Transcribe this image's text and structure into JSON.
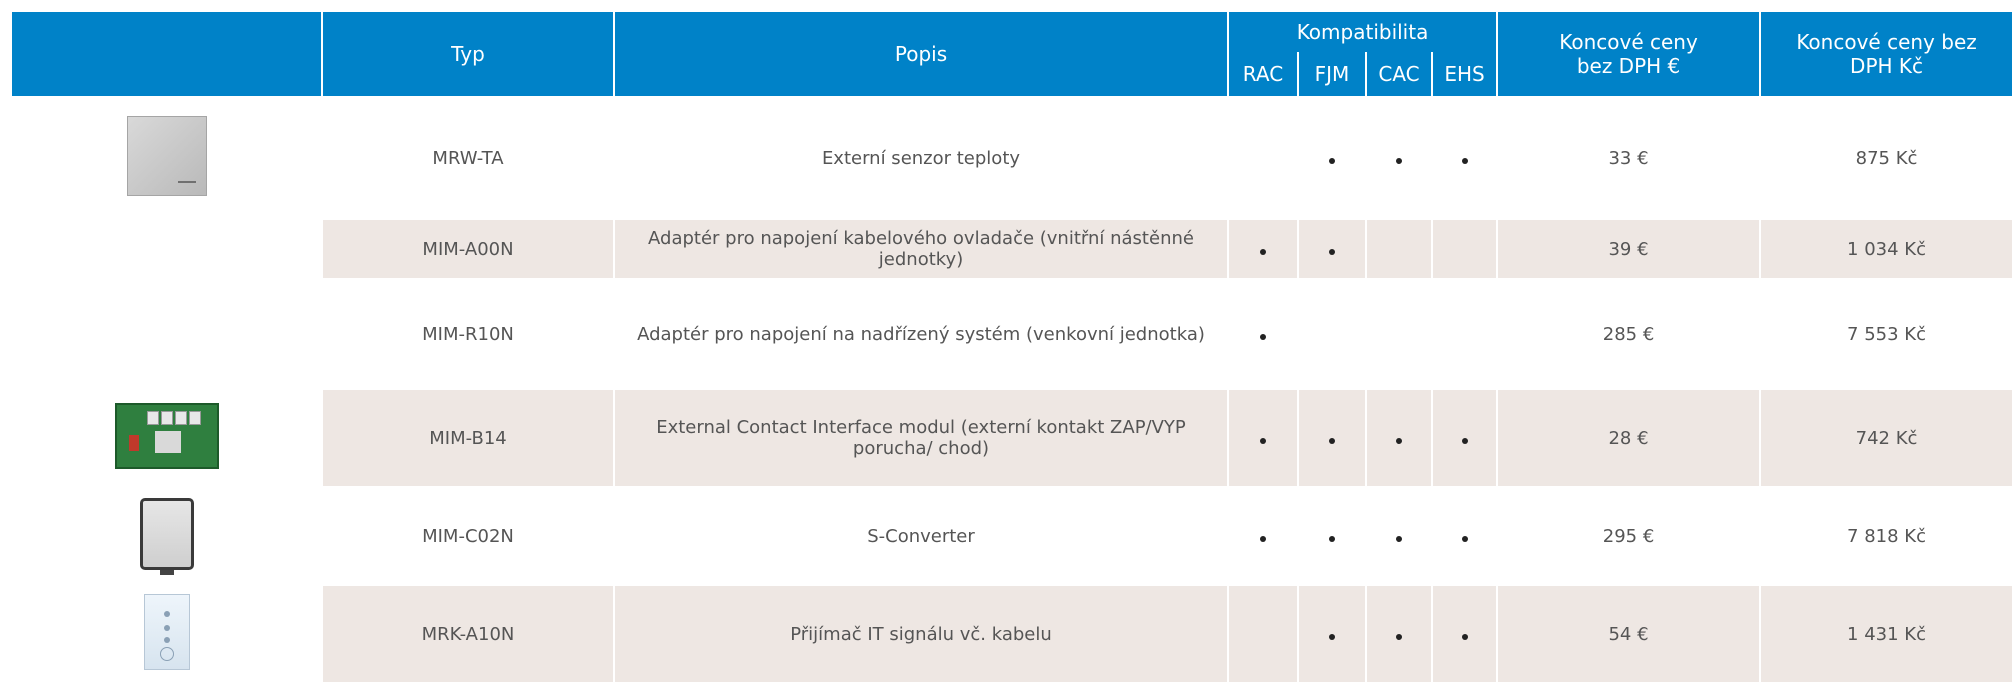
{
  "header": {
    "typ": "Typ",
    "popis": "Popis",
    "kompatibilita": "Kompatibilita",
    "compat_cols": [
      "RAC",
      "FJM",
      "CAC",
      "EHS"
    ],
    "price_eur_line1": "Koncové ceny",
    "price_eur_line2": "bez DPH €",
    "price_czk_line1": "Koncové ceny bez",
    "price_czk_line2": "DPH Kč"
  },
  "rows": [
    {
      "typ": "MRW-TA",
      "popis": "Externí senzor teploty",
      "compat": [
        false,
        true,
        true,
        true
      ],
      "price_eur": "33 €",
      "price_czk": "875 Kč",
      "image": "temperature-sensor"
    },
    {
      "typ": "MIM-A00N",
      "popis": "Adaptér pro napojení kabelového ovladače (vnitřní nástěnné jednotky)",
      "compat": [
        true,
        true,
        false,
        false
      ],
      "price_eur": "39 €",
      "price_czk": "1 034 Kč",
      "image": ""
    },
    {
      "typ": "MIM-R10N",
      "popis": "Adaptér pro napojení na nadřízený systém (venkovní jednotka)",
      "compat": [
        true,
        false,
        false,
        false
      ],
      "price_eur": "285 €",
      "price_czk": "7 553 Kč",
      "image": ""
    },
    {
      "typ": "MIM-B14",
      "popis": "External Contact Interface modul (externí kontakt ZAP/VYP  porucha/ chod)",
      "compat": [
        true,
        true,
        true,
        true
      ],
      "price_eur": "28 €",
      "price_czk": "742 Kč",
      "image": "circuit-board"
    },
    {
      "typ": "MIM-C02N",
      "popis": "S-Converter",
      "compat": [
        true,
        true,
        true,
        true
      ],
      "price_eur": "295 €",
      "price_czk": "7 818 Kč",
      "image": "s-converter-box"
    },
    {
      "typ": "MRK-A10N",
      "popis": "Přijímač IT signálu vč. kabelu",
      "compat": [
        false,
        true,
        true,
        true
      ],
      "price_eur": "54 €",
      "price_czk": "1 431 Kč",
      "image": "ir-receiver"
    }
  ],
  "colors": {
    "header_bg": "#0082c8",
    "row_shade": "#eee7e3",
    "text": "#555555"
  }
}
